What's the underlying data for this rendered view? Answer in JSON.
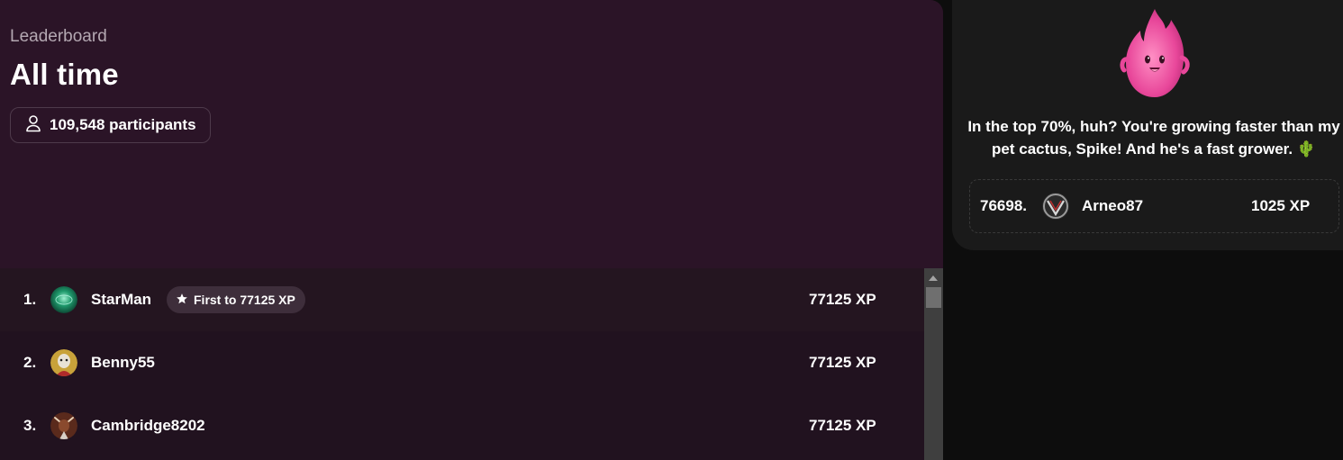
{
  "header": {
    "eyebrow": "Leaderboard",
    "title": "All time",
    "participants_label": "109,548 participants"
  },
  "leaderboard": {
    "rows": [
      {
        "rank": "1.",
        "name": "StarMan",
        "badge": "First to 77125 XP",
        "xp": "77125 XP",
        "avatar": "green-orb-avatar"
      },
      {
        "rank": "2.",
        "name": "Benny55",
        "xp": "77125 XP",
        "avatar": "clown-avatar"
      },
      {
        "rank": "3.",
        "name": "Cambridge8202",
        "xp": "77125 XP",
        "avatar": "bull-avatar"
      }
    ]
  },
  "side_panel": {
    "mascot": "pink-flame-mascot",
    "message": "In the top 70%, huh? You're growing faster than my pet cactus, Spike! And he's a fast grower. 🌵",
    "current_user": {
      "rank": "76698.",
      "name": "Arneo87",
      "xp": "1025 XP",
      "avatar": "shield-logo-avatar"
    }
  },
  "colors": {
    "hero_bg": "#2b1427",
    "list_bg": "#21121f",
    "side_bg": "#1a1a1a",
    "badge_bg": "#3e2e3b",
    "mascot_pink": "#e85aa5"
  }
}
